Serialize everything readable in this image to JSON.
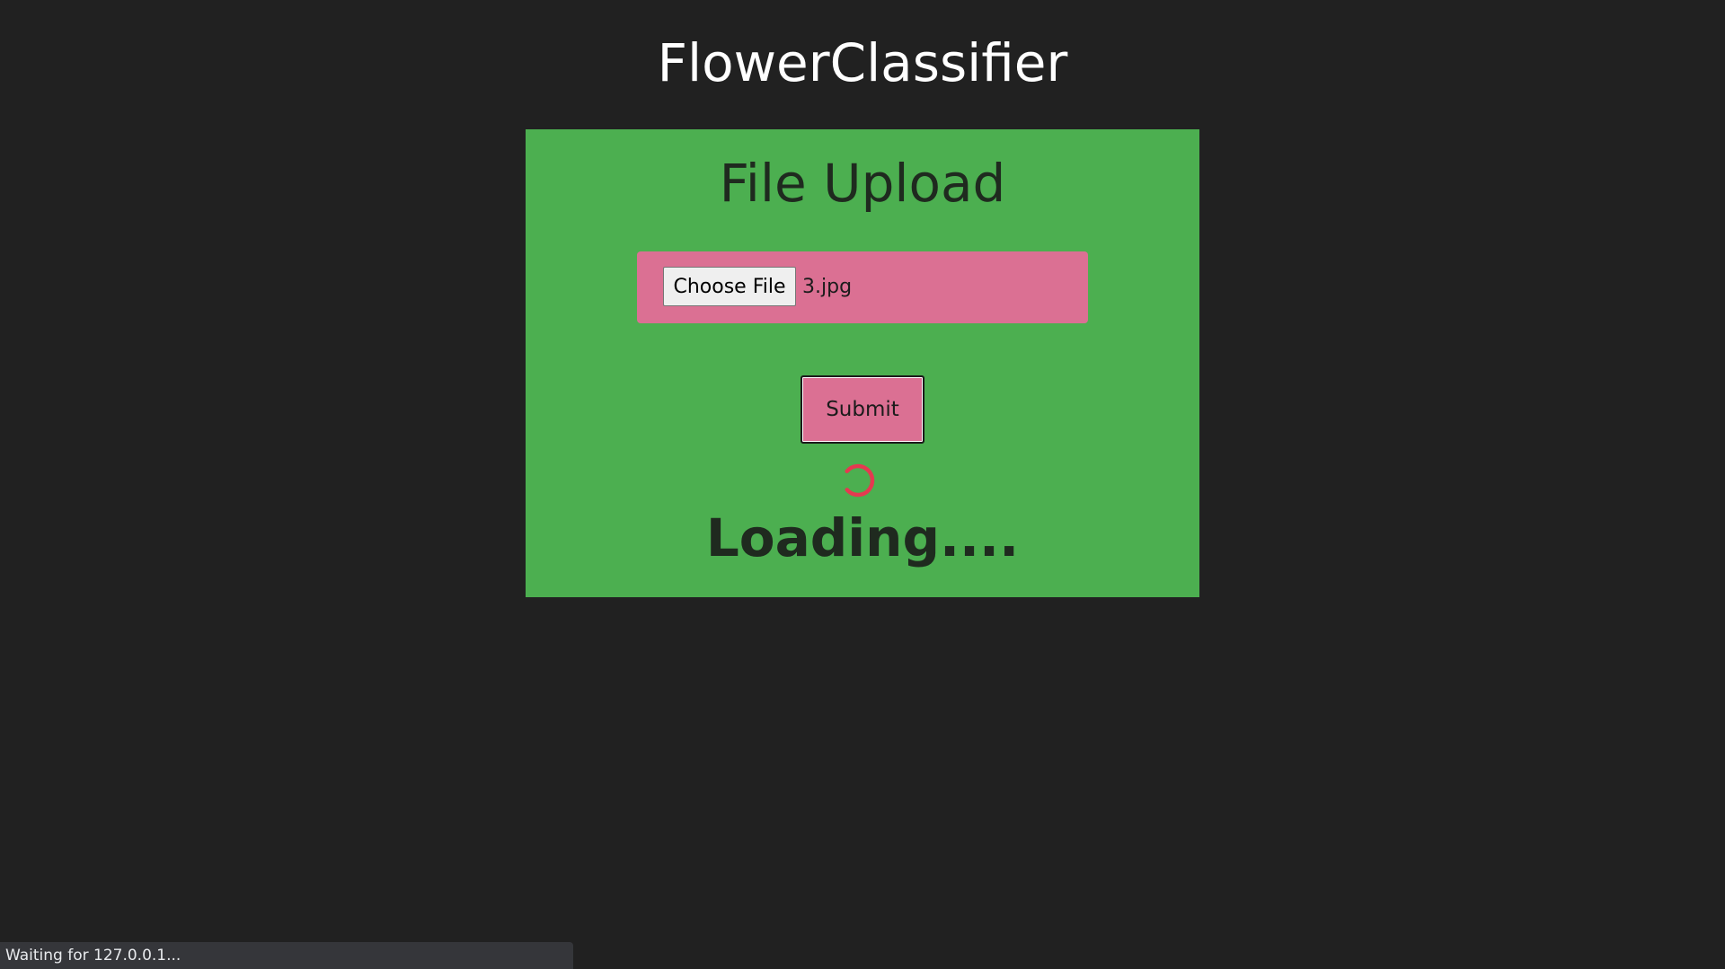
{
  "app": {
    "title": "FlowerClassifier"
  },
  "upload_panel": {
    "title": "File Upload",
    "choose_file_label": "Choose File",
    "selected_file": "3.jpg",
    "submit_label": "Submit",
    "loading_text": "Loading....",
    "spinner_icon": "loading-spinner-icon"
  },
  "status_bar": {
    "text": "Waiting for 127.0.0.1..."
  },
  "colors": {
    "background": "#212121",
    "panel": "#4caf50",
    "accent_pink": "#db7093",
    "spinner": "#e53950"
  }
}
